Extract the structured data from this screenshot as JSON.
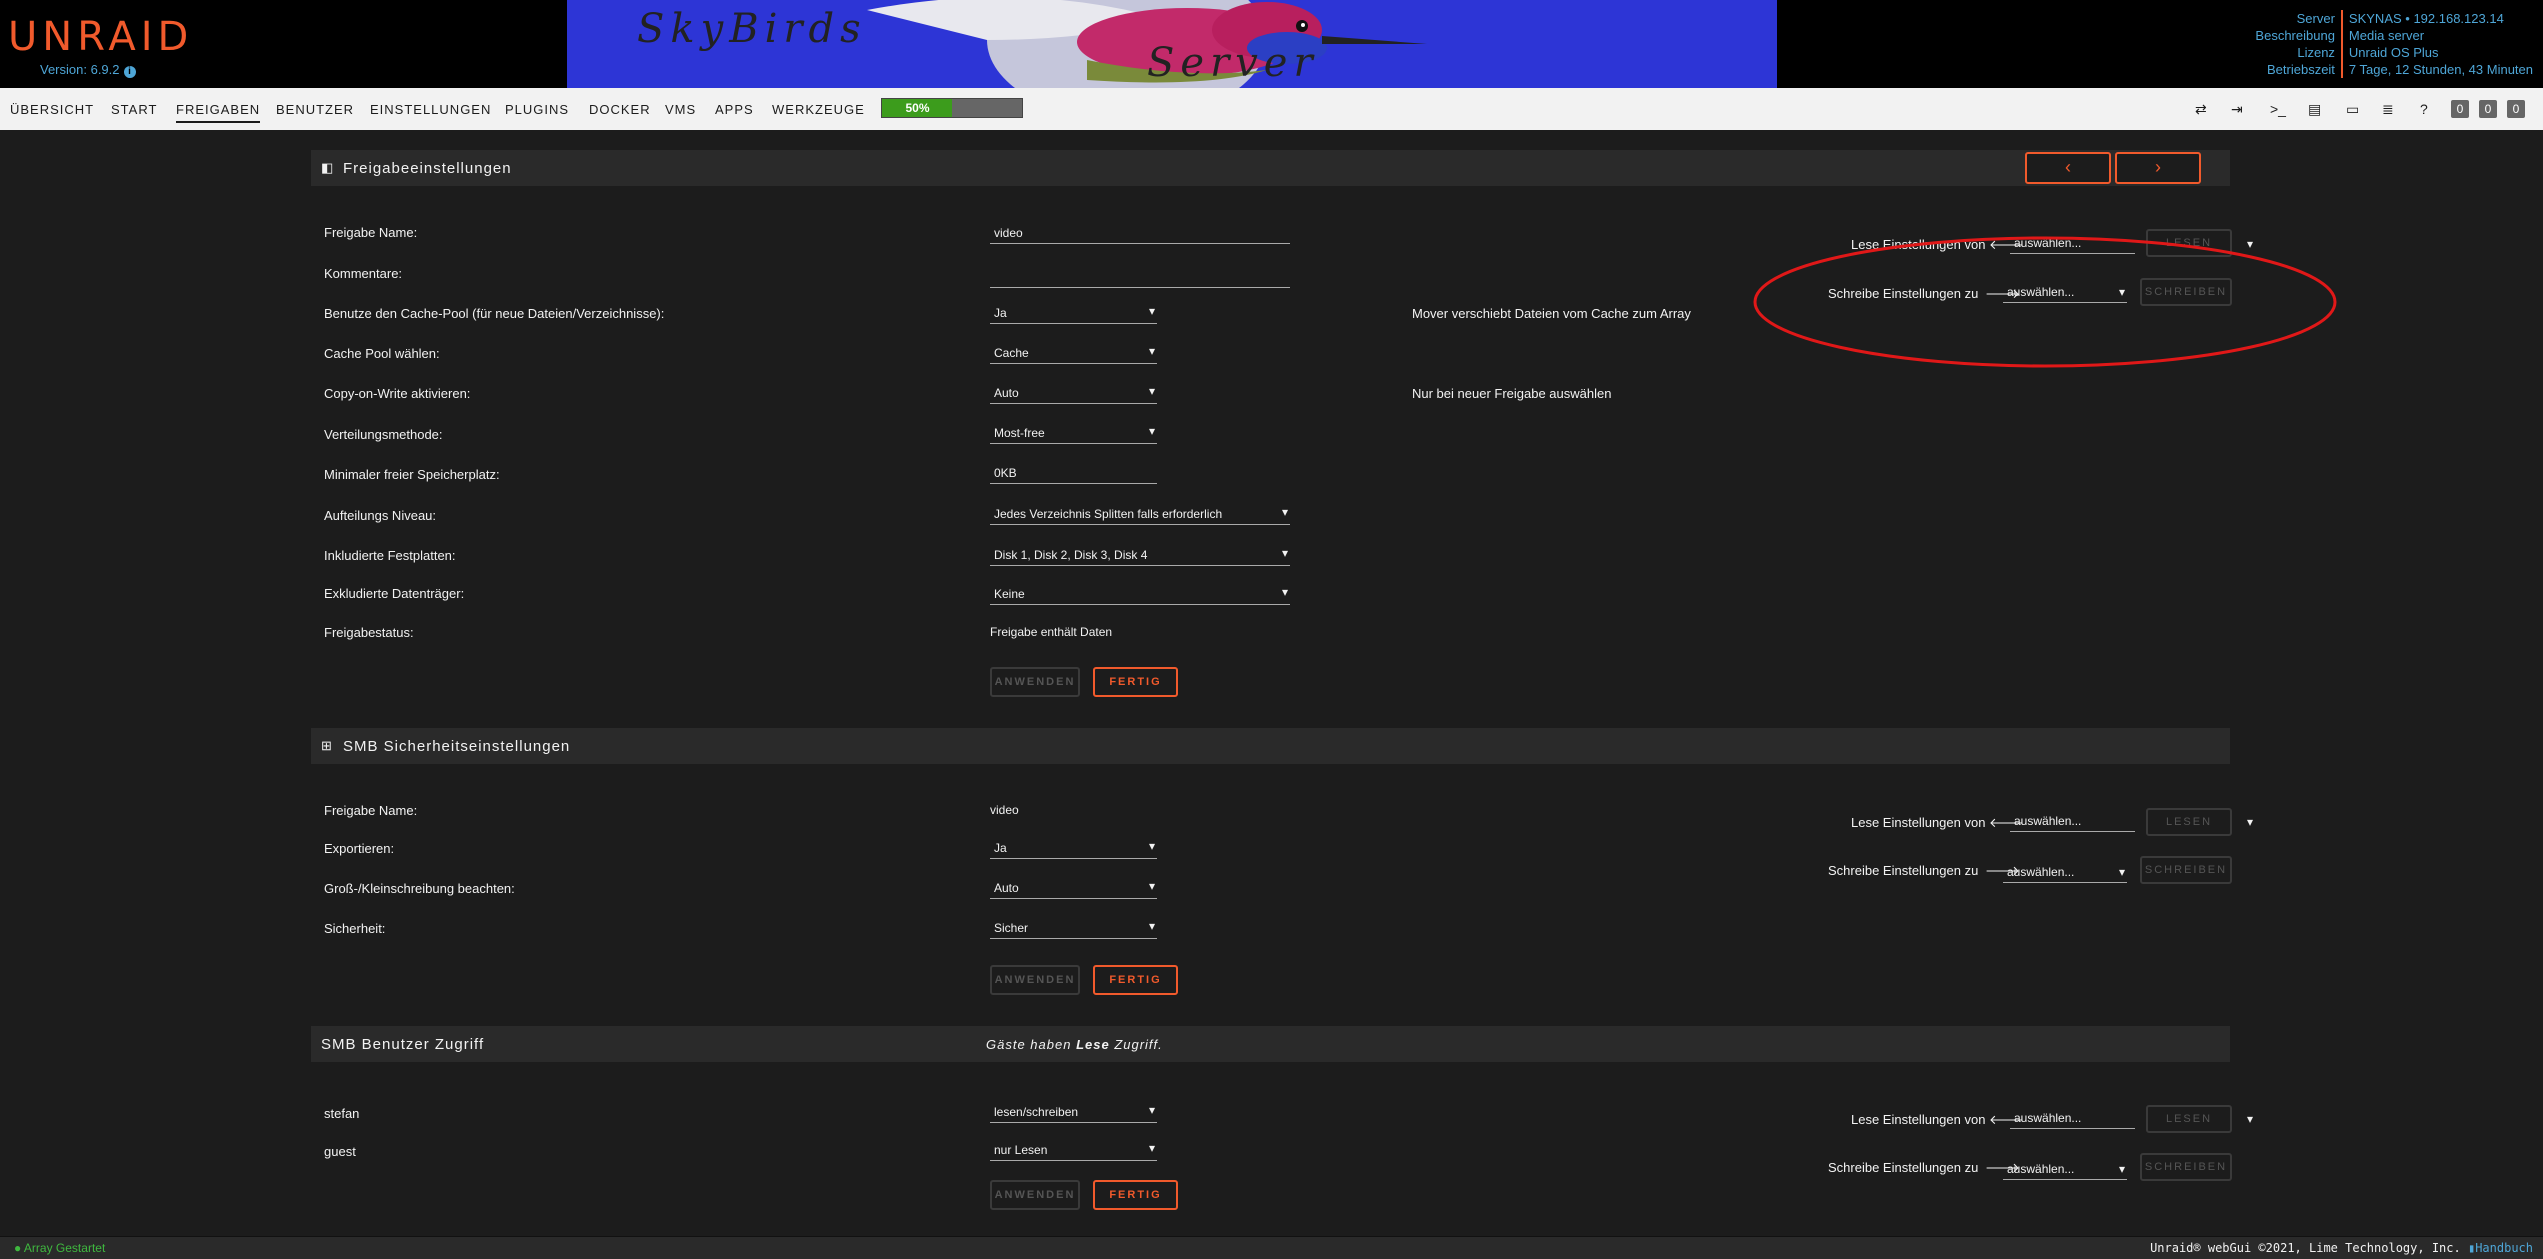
{
  "app": {
    "logo": "UNRAID",
    "version": "Version: 6.9.2",
    "banner_line1": "SkyBirds",
    "banner_line2": "Server",
    "server_labels": [
      "Server",
      "Beschreibung",
      "Lizenz",
      "Betriebszeit"
    ],
    "server_values": [
      "SKYNAS • 192.168.123.14",
      "Media server",
      "Unraid OS Plus",
      "7 Tage, 12 Stunden, 43 Minuten"
    ]
  },
  "nav": {
    "items": [
      "ÜBERSICHT",
      "START",
      "FREIGABEN",
      "BENUTZER",
      "EINSTELLUNGEN",
      "PLUGINS",
      "DOCKER",
      "VMS",
      "APPS",
      "WERKZEUGE"
    ],
    "active": "FREIGABEN",
    "progress": {
      "label": "50%",
      "value": 0.5,
      "color": "#3c9c1c"
    },
    "counts": [
      "0",
      "0",
      "0"
    ]
  },
  "share": {
    "title": "Freigabeeinstellungen",
    "rows": [
      {
        "label": "Freigabe Name:",
        "value": "video"
      },
      {
        "label": "Kommentare:",
        "value": ""
      },
      {
        "label": "Benutze den Cache-Pool (für neue Dateien/Verzeichnisse):",
        "value": "Ja",
        "note": "Mover verschiebt Dateien vom Cache zum Array"
      },
      {
        "label": "Cache Pool wählen:",
        "value": "Cache"
      },
      {
        "label": "Copy-on-Write aktivieren:",
        "value": "Auto",
        "note": "Nur bei neuer Freigabe auswählen"
      },
      {
        "label": "Verteilungsmethode:",
        "value": "Most-free"
      },
      {
        "label": "Minimaler freier Speicherplatz:",
        "value": "0KB"
      },
      {
        "label": "Aufteilungs Niveau:",
        "value": "Jedes Verzeichnis Splitten falls erforderlich"
      },
      {
        "label": "Inkludierte Festplatten:",
        "value": "Disk 1, Disk 2, Disk 3, Disk 4"
      },
      {
        "label": "Exkludierte Datenträger:",
        "value": "Keine"
      },
      {
        "label": "Freigabestatus:",
        "value": "Freigabe enthält Daten"
      }
    ],
    "apply": "ANWENDEN",
    "done": "FERTIG"
  },
  "smb": {
    "title": "SMB Sicherheitseinstellungen",
    "rows": [
      {
        "label": "Freigabe Name:",
        "value": "video"
      },
      {
        "label": "Exportieren:",
        "value": "Ja"
      },
      {
        "label": "Groß-/Kleinschreibung beachten:",
        "value": "Auto"
      },
      {
        "label": "Sicherheit:",
        "value": "Sicher"
      }
    ],
    "apply": "ANWENDEN",
    "done": "FERTIG"
  },
  "users": {
    "title": "SMB Benutzer Zugriff",
    "guest_note_prefix": "Gäste haben ",
    "guest_note_bold": "Lese",
    "guest_note_suffix": " Zugriff.",
    "rows": [
      {
        "label": "stefan",
        "value": "lesen/schreiben"
      },
      {
        "label": "guest",
        "value": "nur Lesen"
      }
    ],
    "apply": "ANWENDEN",
    "done": "FERTIG"
  },
  "copy": {
    "read_label": "Lese Einstellungen von",
    "write_label": "Schreibe Einstellungen zu",
    "select": "auswählen...",
    "read_btn": "LESEN",
    "write_btn": "SCHREIBEN"
  },
  "footer": {
    "status": "Array Gestartet",
    "copyright": "Unraid® webGui ©2021, Lime Technology, Inc.",
    "handbook": "Handbuch"
  }
}
